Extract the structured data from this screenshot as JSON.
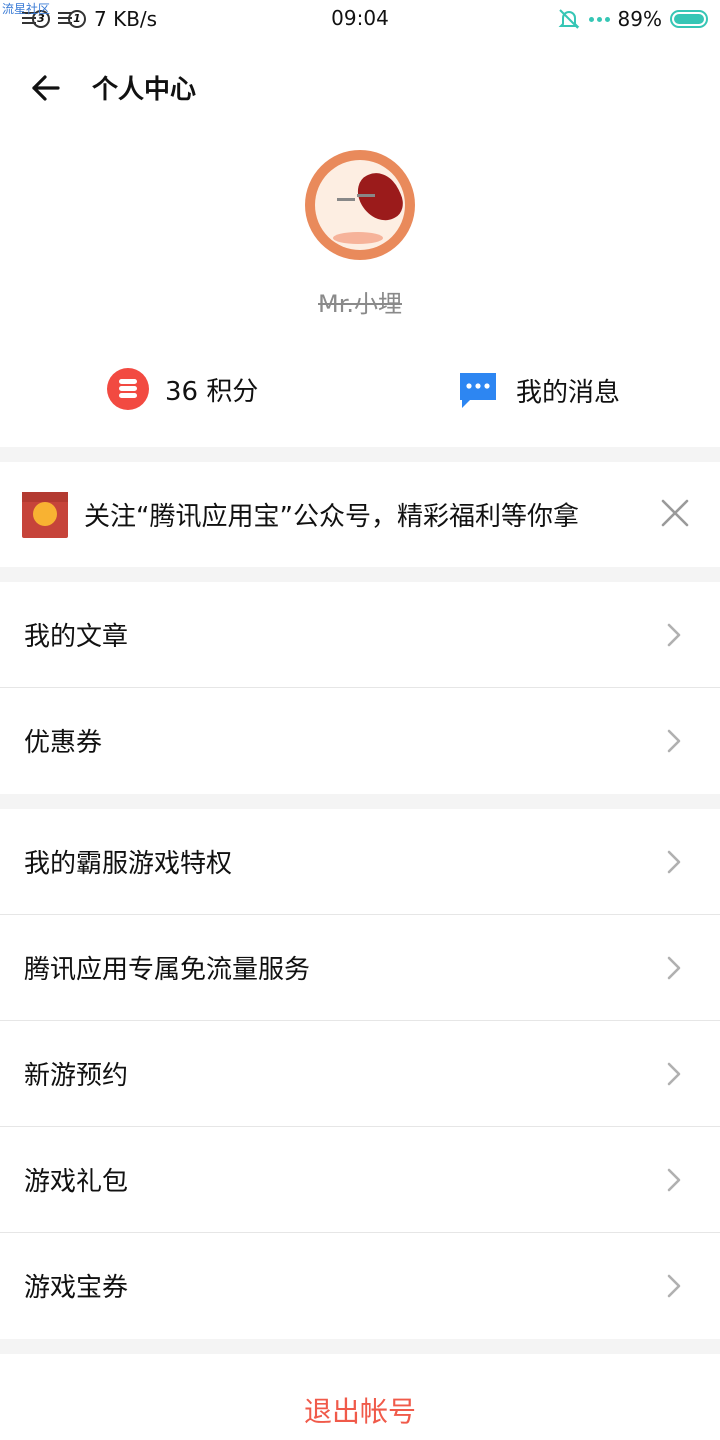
{
  "watermark": "流星社区",
  "status_bar": {
    "sim1": "3",
    "sim2": "1",
    "speed": "7 KB/s",
    "time": "09:04",
    "battery": "89%",
    "accent": "#36c6b5"
  },
  "header": {
    "title": "个人中心",
    "back_icon": "arrow-left-icon"
  },
  "profile": {
    "username": "Mr.小埋",
    "points_label": "36 积分",
    "messages_label": "我的消息",
    "points_icon": "coin-stack-icon",
    "messages_icon": "chat-bubble-icon"
  },
  "banner": {
    "text": "关注“腾讯应用宝”公众号，精彩福利等你拿",
    "icon": "red-envelope-icon",
    "close_icon": "close-icon"
  },
  "group1": [
    {
      "label": "我的文章"
    },
    {
      "label": "优惠券"
    }
  ],
  "group2": [
    {
      "label": "我的霸服游戏特权"
    },
    {
      "label": "腾讯应用专属免流量服务"
    },
    {
      "label": "新游预约"
    },
    {
      "label": "游戏礼包"
    },
    {
      "label": "游戏宝券"
    }
  ],
  "logout": {
    "label": "退出帐号",
    "color": "#f05a4a"
  }
}
